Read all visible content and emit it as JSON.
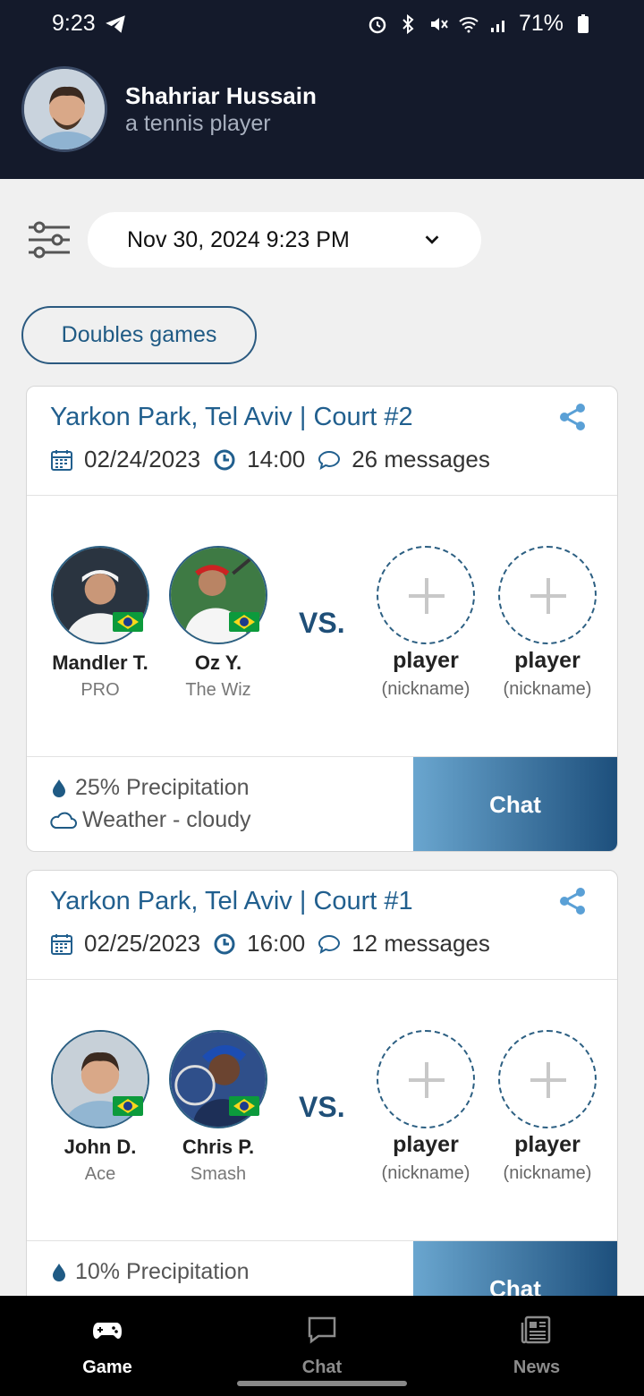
{
  "status": {
    "time": "9:23",
    "battery": "71%"
  },
  "user": {
    "name": "Shahriar Hussain",
    "subtitle": "a tennis player"
  },
  "filter": {
    "datetime": "Nov 30, 2024 9:23 PM",
    "doubles_label": "Doubles games"
  },
  "games": [
    {
      "title": "Yarkon Park, Tel Aviv | Court #2",
      "date": "02/24/2023",
      "time": "14:00",
      "messages": "26 messages",
      "players": [
        {
          "name": "Mandler T.",
          "nickname": "PRO"
        },
        {
          "name": "Oz Y.",
          "nickname": "The Wiz"
        }
      ],
      "vs": "VS.",
      "open_slots": [
        {
          "name": "player",
          "nickname": "(nickname)"
        },
        {
          "name": "player",
          "nickname": "(nickname)"
        }
      ],
      "precipitation": "25% Precipitation",
      "weather": "Weather - cloudy",
      "chat_label": "Chat"
    },
    {
      "title": "Yarkon Park, Tel Aviv | Court #1",
      "date": "02/25/2023",
      "time": "16:00",
      "messages": "12 messages",
      "players": [
        {
          "name": "John D.",
          "nickname": "Ace"
        },
        {
          "name": "Chris P.",
          "nickname": "Smash"
        }
      ],
      "vs": "VS.",
      "open_slots": [
        {
          "name": "player",
          "nickname": "(nickname)"
        },
        {
          "name": "player",
          "nickname": "(nickname)"
        }
      ],
      "precipitation": "10% Precipitation",
      "weather": "",
      "chat_label": "Chat"
    }
  ],
  "nav": {
    "items": [
      {
        "label": "Game",
        "icon": "gamepad-icon",
        "active": true
      },
      {
        "label": "Chat",
        "icon": "chat-icon",
        "active": false
      },
      {
        "label": "News",
        "icon": "news-icon",
        "active": false
      }
    ]
  },
  "colors": {
    "header_bg": "#141a2b",
    "accent": "#215f8e",
    "chat_gradient_start": "#6aa6cf",
    "chat_gradient_end": "#1d4f7c"
  }
}
